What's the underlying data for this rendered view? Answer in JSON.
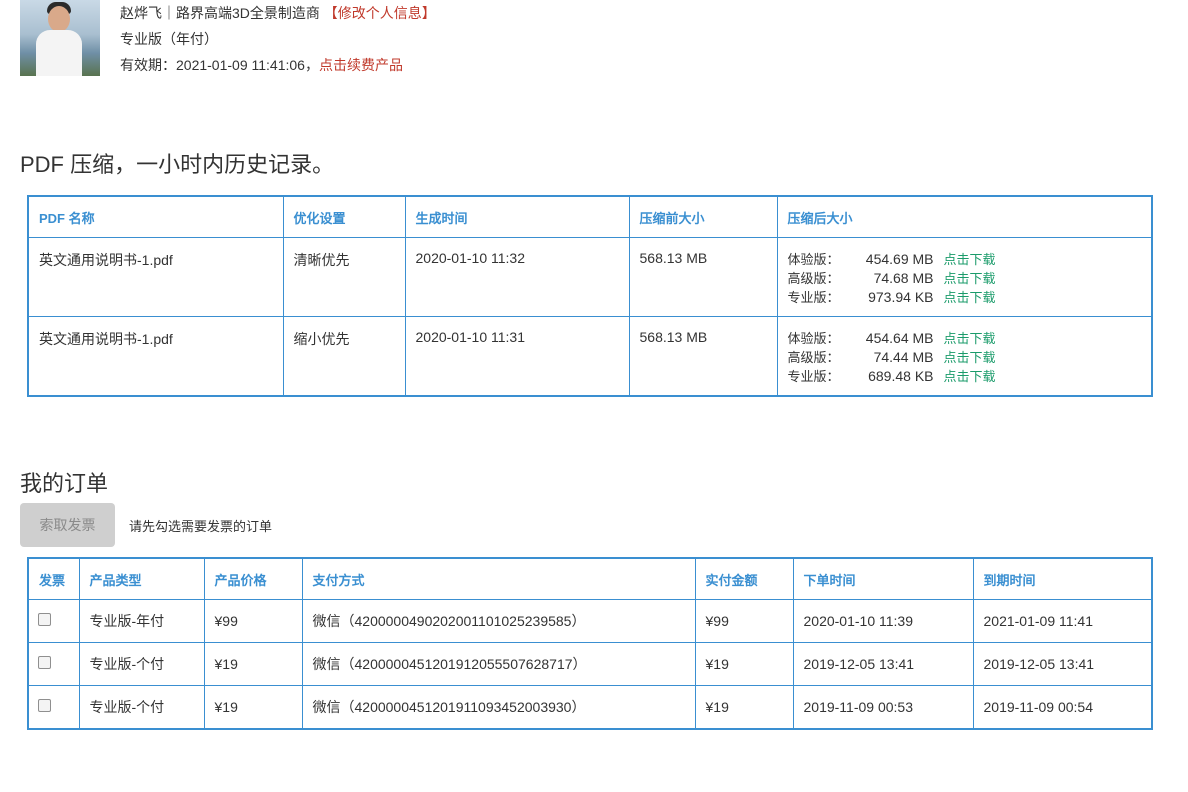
{
  "profile": {
    "name_line": "赵烨飞｜路界高端3D全景制造商 ",
    "edit_link": "【修改个人信息】",
    "plan": "专业版（年付）",
    "validity_prefix": "有效期：2021-01-09 11:41:06，",
    "renew_link": "点击续费产品"
  },
  "history": {
    "title": "PDF 压缩，一小时内历史记录。",
    "headers": [
      "PDF 名称",
      "优化设置",
      "生成时间",
      "压缩前大小",
      "压缩后大小"
    ],
    "rows": [
      {
        "name": "英文通用说明书-1.pdf",
        "setting": "清晰优先",
        "time": "2020-01-10 11:32",
        "before": "568.13 MB",
        "sizes": [
          {
            "label": "体验版：",
            "value": "454.69 MB",
            "link": "点击下载"
          },
          {
            "label": "高级版：",
            "value": "74.68 MB",
            "link": "点击下载"
          },
          {
            "label": "专业版：",
            "value": "973.94 KB",
            "link": "点击下载"
          }
        ]
      },
      {
        "name": "英文通用说明书-1.pdf",
        "setting": "缩小优先",
        "time": "2020-01-10 11:31",
        "before": "568.13 MB",
        "sizes": [
          {
            "label": "体验版：",
            "value": "454.64 MB",
            "link": "点击下载"
          },
          {
            "label": "高级版：",
            "value": "74.44 MB",
            "link": "点击下载"
          },
          {
            "label": "专业版：",
            "value": "689.48 KB",
            "link": "点击下载"
          }
        ]
      }
    ]
  },
  "orders": {
    "title": "我的订单",
    "invoice_button": "索取发票",
    "hint": "请先勾选需要发票的订单",
    "headers": [
      "发票",
      "产品类型",
      "产品价格",
      "支付方式",
      "实付金额",
      "下单时间",
      "到期时间"
    ],
    "rows": [
      {
        "type": "专业版-年付",
        "price": "¥99",
        "payment": "微信（4200000490202001101025239585）",
        "paid": "¥99",
        "order_time": "2020-01-10 11:39",
        "expire_time": "2021-01-09 11:41"
      },
      {
        "type": "专业版-个付",
        "price": "¥19",
        "payment": "微信（4200000451201912055507628717）",
        "paid": "¥19",
        "order_time": "2019-12-05 13:41",
        "expire_time": "2019-12-05 13:41"
      },
      {
        "type": "专业版-个付",
        "price": "¥19",
        "payment": "微信（4200000451201911093452003930）",
        "paid": "¥19",
        "order_time": "2019-11-09 00:53",
        "expire_time": "2019-11-09 00:54"
      }
    ]
  }
}
